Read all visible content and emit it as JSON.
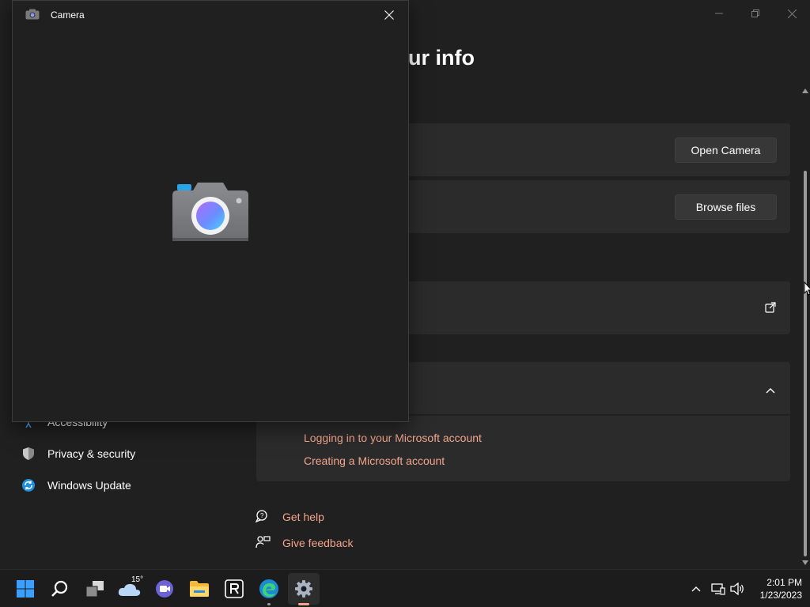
{
  "settings": {
    "title_partial": "ur info",
    "open_camera_label": "Open Camera",
    "browse_files_label": "Browse files",
    "sidebar": {
      "items": [
        {
          "label": "Accessibility",
          "icon": "accessibility-icon"
        },
        {
          "label": "Privacy & security",
          "icon": "shield-icon"
        },
        {
          "label": "Windows Update",
          "icon": "windows-update-icon"
        }
      ]
    },
    "related_links": [
      "Logging in to your Microsoft account",
      "Creating a Microsoft account"
    ],
    "help": {
      "get_help": "Get help",
      "give_feedback": "Give feedback"
    }
  },
  "camera_window": {
    "title": "Camera"
  },
  "taskbar": {
    "weather_temp": "15°",
    "time": "2:01 PM",
    "date": "1/23/2023"
  },
  "colors": {
    "accent_link": "#f2a58a",
    "background": "#202020",
    "card": "#2b2b2b"
  }
}
